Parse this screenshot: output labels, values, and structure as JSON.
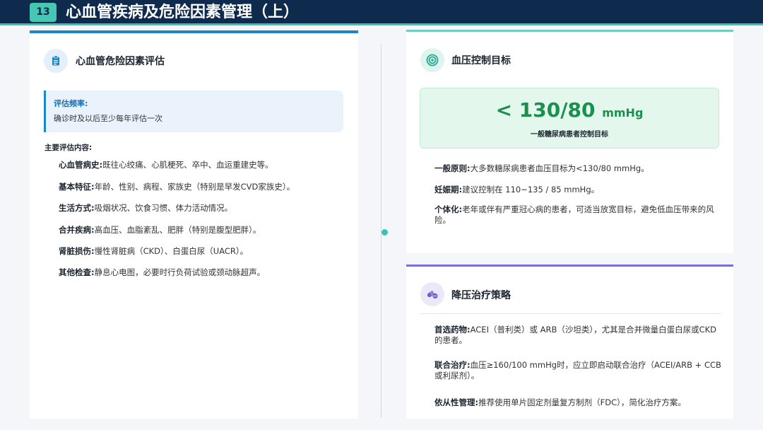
{
  "header": {
    "page_number": "13",
    "title": "心血管疾病及危险因素管理（上）"
  },
  "colors": {
    "header_bg": "#0e2a4d",
    "accent_teal": "#3cc3b0",
    "accent_blue": "#1a87c8",
    "accent_green": "#1a8f50",
    "accent_purple": "#7b6fd6"
  },
  "left": {
    "icon": "clipboard-icon",
    "title": "心血管危险因素评估",
    "frequency": {
      "label": "评估频率:",
      "text": "确诊时及以后至少每年评估一次"
    },
    "section_label": "主要评估内容:",
    "items": [
      {
        "label": "心血管病史:",
        "text": "既往心绞痛、心肌梗死、卒中、血运重建史等。"
      },
      {
        "label": "基本特征:",
        "text": "年龄、性别、病程、家族史（特别是早发CVD家族史）。"
      },
      {
        "label": "生活方式:",
        "text": "吸烟状况、饮食习惯、体力活动情况。"
      },
      {
        "label": "合并疾病:",
        "text": "高血压、血脂紊乱、肥胖（特别是腹型肥胖）。"
      },
      {
        "label": "肾脏损伤:",
        "text": "慢性肾脏病（CKD）、白蛋白尿（UACR）。"
      },
      {
        "label": "其他检查:",
        "text": "静息心电图，必要时行负荷试验或颈动脉超声。"
      }
    ]
  },
  "bp": {
    "icon": "target-icon",
    "title": "血压控制目标",
    "target_value": "< 130/80",
    "target_unit": "mmHg",
    "target_caption": "一般糖尿病患者控制目标",
    "paragraphs": [
      {
        "label": "一般原则:",
        "text": "大多数糖尿病患者血压目标为<130/80 mmHg。"
      },
      {
        "label": "妊娠期:",
        "text": "建议控制在 110~135 / 85 mmHg。"
      },
      {
        "label": "个体化:",
        "text": "老年或伴有严重冠心病的患者，可适当放宽目标，避免低血压带来的风险。"
      }
    ]
  },
  "treatment": {
    "icon": "pills-icon",
    "title": "降压治疗策略",
    "paragraphs": [
      {
        "label": "首选药物:",
        "text": "ACEI（普利类）或 ARB（沙坦类），尤其是合并微量白蛋白尿或CKD的患者。"
      },
      {
        "label": "联合治疗:",
        "text": "血压≥160/100 mmHg时，应立即启动联合治疗（ACEI/ARB + CCB或利尿剂）。"
      },
      {
        "label": "依从性管理:",
        "text": "推荐使用单片固定剂量复方制剂（FDC），简化治疗方案。"
      }
    ]
  }
}
